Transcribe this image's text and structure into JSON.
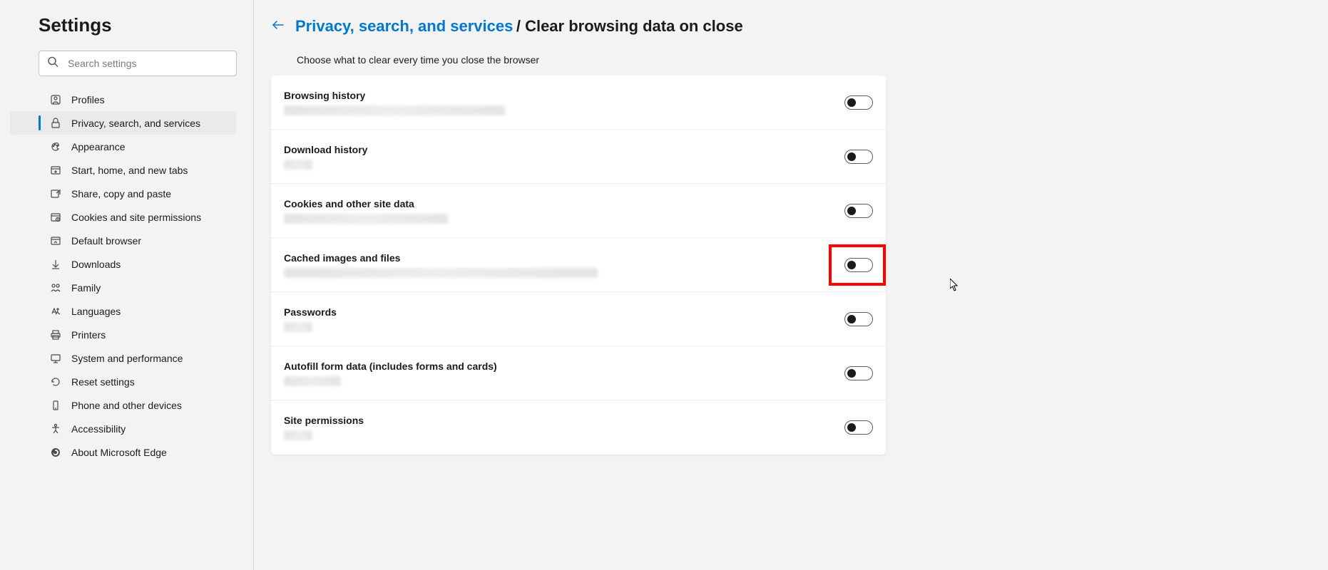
{
  "sidebar": {
    "title": "Settings",
    "searchPlaceholder": "Search settings",
    "items": [
      {
        "label": "Profiles",
        "icon": "profile"
      },
      {
        "label": "Privacy, search, and services",
        "icon": "lock"
      },
      {
        "label": "Appearance",
        "icon": "appearance"
      },
      {
        "label": "Start, home, and new tabs",
        "icon": "newtab"
      },
      {
        "label": "Share, copy and paste",
        "icon": "share"
      },
      {
        "label": "Cookies and site permissions",
        "icon": "cookie"
      },
      {
        "label": "Default browser",
        "icon": "browser"
      },
      {
        "label": "Downloads",
        "icon": "download"
      },
      {
        "label": "Family",
        "icon": "family"
      },
      {
        "label": "Languages",
        "icon": "language"
      },
      {
        "label": "Printers",
        "icon": "printer"
      },
      {
        "label": "System and performance",
        "icon": "system"
      },
      {
        "label": "Reset settings",
        "icon": "reset"
      },
      {
        "label": "Phone and other devices",
        "icon": "phone"
      },
      {
        "label": "Accessibility",
        "icon": "accessibility"
      },
      {
        "label": "About Microsoft Edge",
        "icon": "about"
      }
    ]
  },
  "breadcrumb": {
    "parent": "Privacy, search, and services",
    "separator": "/",
    "current": "Clear browsing data on close"
  },
  "subtitle": "Choose what to clear every time you close the browser",
  "settings": [
    {
      "title": "Browsing history",
      "descClass": "desc-long",
      "highlighted": false
    },
    {
      "title": "Download history",
      "descClass": "desc-short",
      "highlighted": false
    },
    {
      "title": "Cookies and other site data",
      "descClass": "desc-med",
      "highlighted": false
    },
    {
      "title": "Cached images and files",
      "descClass": "desc-xlong",
      "highlighted": true
    },
    {
      "title": "Passwords",
      "descClass": "desc-short",
      "highlighted": false
    },
    {
      "title": "Autofill form data (includes forms and cards)",
      "descClass": "desc-sm",
      "highlighted": false
    },
    {
      "title": "Site permissions",
      "descClass": "desc-short",
      "highlighted": false
    }
  ]
}
